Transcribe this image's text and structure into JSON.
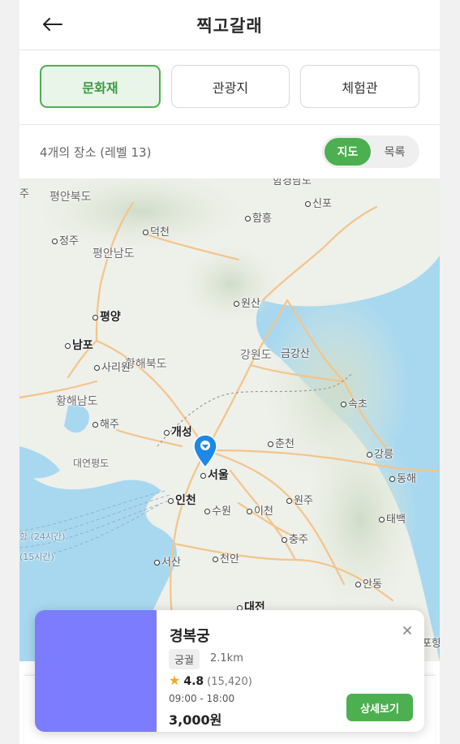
{
  "header": {
    "back_icon": "arrow-left-icon",
    "title": "찍고갈래"
  },
  "categories": [
    {
      "label": "문화재",
      "active": true
    },
    {
      "label": "관광지",
      "active": false
    },
    {
      "label": "체험관",
      "active": false
    }
  ],
  "summary": {
    "count_text": "4개의 장소 (레벨 13)"
  },
  "view_toggle": {
    "map_label": "지도",
    "list_label": "목록",
    "selected": "지도"
  },
  "map": {
    "labels": {
      "ju": "주",
      "pyeongan_n": "평안북도",
      "deokcheon": "덕천",
      "hamheung": "함흥",
      "sinpo": "신포",
      "jeongju": "정주",
      "pyeongan_s": "평안남도",
      "wonsan": "원산",
      "pyongyang": "평양",
      "nampo": "남포",
      "sariwon": "사리원",
      "hwanghae_n": "황해북도",
      "gangwon": "강원도",
      "geumgangsan": "금강산",
      "hwanghae_s": "황해남도",
      "sokcho": "속초",
      "haeju": "해주",
      "gaeseong": "개성",
      "chuncheon": "춘천",
      "gangneung": "강릉",
      "yeonpyeong": "대연평도",
      "seoul": "서울",
      "donghae": "동해",
      "incheon": "인천",
      "suwon": "수원",
      "icheon": "이천",
      "wonju": "원주",
      "taebaek": "태백",
      "chungju": "충주",
      "seosan": "서산",
      "cheonan": "천안",
      "andong": "안동",
      "daejeon": "대전",
      "ferry_24": "항 (24시간)",
      "ferry_15": "(15시간)",
      "partial_top": "함경남도",
      "partial_right": "포항"
    }
  },
  "place_card": {
    "name": "경복궁",
    "category": "궁궐",
    "distance": "2.1km",
    "rating": "4.8",
    "reviews": "(15,420)",
    "hours": "09:00 - 18:00",
    "price": "3,000원",
    "detail_button": "상세보기",
    "close_icon": "close-icon",
    "thumbnail_color": "#7c7cff"
  },
  "colors": {
    "accent": "#4caf50",
    "accent_light": "#e9f5e9",
    "pin": "#1e88e5",
    "star": "#f5a623"
  }
}
